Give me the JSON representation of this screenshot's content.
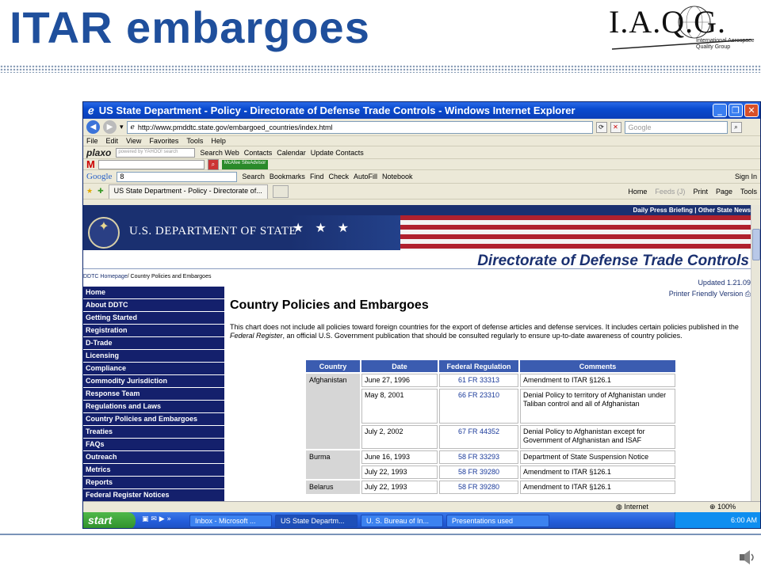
{
  "slide": {
    "title": "ITAR embargoes",
    "logo_text": "I.A.Q.G.",
    "logo_sub1": "International Aerospace",
    "logo_sub2": "Quality Group"
  },
  "browser": {
    "window_title": "US State Department - Policy - Directorate of Defense Trade Controls - Windows Internet Explorer",
    "url": "http://www.pmddtc.state.gov/embargoed_countries/index.html",
    "search_placeholder": "Google",
    "menu": [
      "File",
      "Edit",
      "View",
      "Favorites",
      "Tools",
      "Help"
    ],
    "plaxo": {
      "logo": "plaxo",
      "yahoo_label": "powered by YAHOO! search",
      "items": [
        "Search Web",
        "Contacts",
        "Calendar",
        "Update Contacts"
      ]
    },
    "mcafee_label": "McAfee SiteAdvisor",
    "google_bar": {
      "logo": "Google",
      "input": "8",
      "items": [
        "Search",
        "Bookmarks",
        "Find",
        "Check",
        "AutoFill",
        "Notebook",
        "Sign In"
      ]
    },
    "tab_label": "US State Department - Policy - Directorate of...",
    "command_bar": [
      "Home",
      "Feeds (J)",
      "Print",
      "Page",
      "Tools"
    ],
    "status": {
      "zone": "Internet",
      "zoom": "100%"
    }
  },
  "page": {
    "top_links": "Daily Press Briefing | Other State News",
    "dept_name": "U.S. DEPARTMENT OF STATE",
    "ddtc_title": "Directorate of Defense Trade Controls",
    "crumb_home": "DDTC Homepage",
    "crumb_current": "/ Country Policies and Embargoes",
    "updated": "Updated 1.21.09",
    "printer": "Printer Friendly Version",
    "nav": [
      "Home",
      "About DDTC",
      "Getting Started",
      "Registration",
      "D-Trade",
      "Licensing",
      "Compliance",
      "Commodity Jurisdiction",
      "Response Team",
      "Regulations and Laws",
      "Country Policies and Embargoes",
      "Treaties",
      "FAQs",
      "Outreach",
      "Metrics",
      "Reports",
      "Federal Register Notices"
    ],
    "heading": "Country Policies and Embargoes",
    "intro_a": "This chart does not include all policies toward foreign countries for the export of defense articles and defense services. It includes certain policies published in the ",
    "intro_em": "Federal Register",
    "intro_b": ", an official U.S. Government publication that should be consulted regularly to ensure up-to-date awareness of country policies.",
    "table_headers": [
      "Country",
      "Date",
      "Federal Regulation",
      "Comments"
    ],
    "rows": [
      {
        "country": "Afghanistan",
        "date": "June 27, 1996",
        "fr": "61 FR 33313",
        "comment": "Amendment to ITAR §126.1"
      },
      {
        "country": "",
        "date": "May 8, 2001",
        "fr": "66 FR 23310",
        "comment": "Denial Policy to territory of Afghanistan under Taliban control and all of Afghanistan"
      },
      {
        "country": "",
        "date": "July 2, 2002",
        "fr": "67 FR 44352",
        "comment": "Denial Policy to Afghanistan except for Government of Afghanistan and ISAF"
      },
      {
        "country": "Burma",
        "date": "June 16, 1993",
        "fr": "58 FR 33293",
        "comment": "Department of State Suspension Notice"
      },
      {
        "country": "",
        "date": "July 22, 1993",
        "fr": "58 FR 39280",
        "comment": "Amendment to ITAR §126.1"
      },
      {
        "country": "Belarus",
        "date": "July 22, 1993",
        "fr": "58 FR 39280",
        "comment": "Amendment to ITAR §126.1"
      }
    ]
  },
  "taskbar": {
    "start": "start",
    "tasks": [
      "Inbox - Microsoft ...",
      "US State Departm...",
      "U. S. Bureau of In...",
      "Presentations used"
    ],
    "time": "6:00 AM"
  }
}
